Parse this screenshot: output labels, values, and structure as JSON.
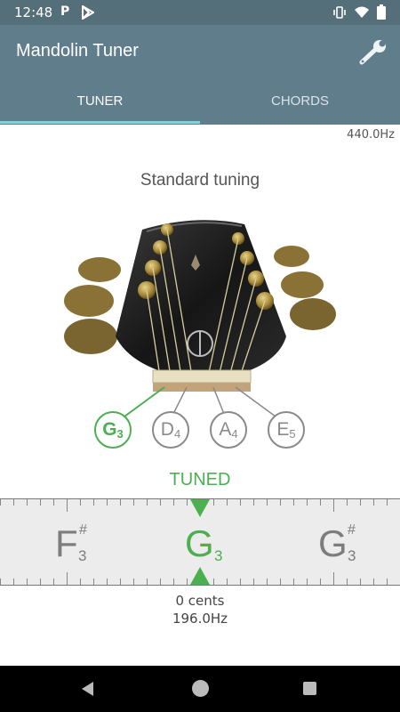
{
  "status_bar": {
    "time": "12:48",
    "left_icons": [
      "parking-icon",
      "play-store-icon"
    ],
    "right_icons": [
      "vibrate-icon",
      "wifi-icon",
      "battery-icon"
    ]
  },
  "app_bar": {
    "title": "Mandolin Tuner",
    "settings_icon": "wrench-icon"
  },
  "tabs": [
    {
      "label": "TUNER",
      "active": true
    },
    {
      "label": "CHORDS",
      "active": false
    }
  ],
  "reference_frequency": "440.0Hz",
  "tuning_name": "Standard tuning",
  "strings": [
    {
      "note": "G",
      "octave": "3",
      "selected": true
    },
    {
      "note": "D",
      "octave": "4",
      "selected": false
    },
    {
      "note": "A",
      "octave": "4",
      "selected": false
    },
    {
      "note": "E",
      "octave": "5",
      "selected": false
    }
  ],
  "tuner": {
    "status": "TUNED",
    "left_note": {
      "note": "F",
      "sharp": "#",
      "octave": "3"
    },
    "center_note": {
      "note": "G",
      "octave": "3"
    },
    "right_note": {
      "note": "G",
      "sharp": "#",
      "octave": "3"
    },
    "cents": "0 cents",
    "frequency": "196.0Hz"
  },
  "colors": {
    "primary": "#607d8b",
    "primary_dark": "#546e7a",
    "accent": "#4caf50",
    "tab_indicator": "#7fd3d9"
  }
}
